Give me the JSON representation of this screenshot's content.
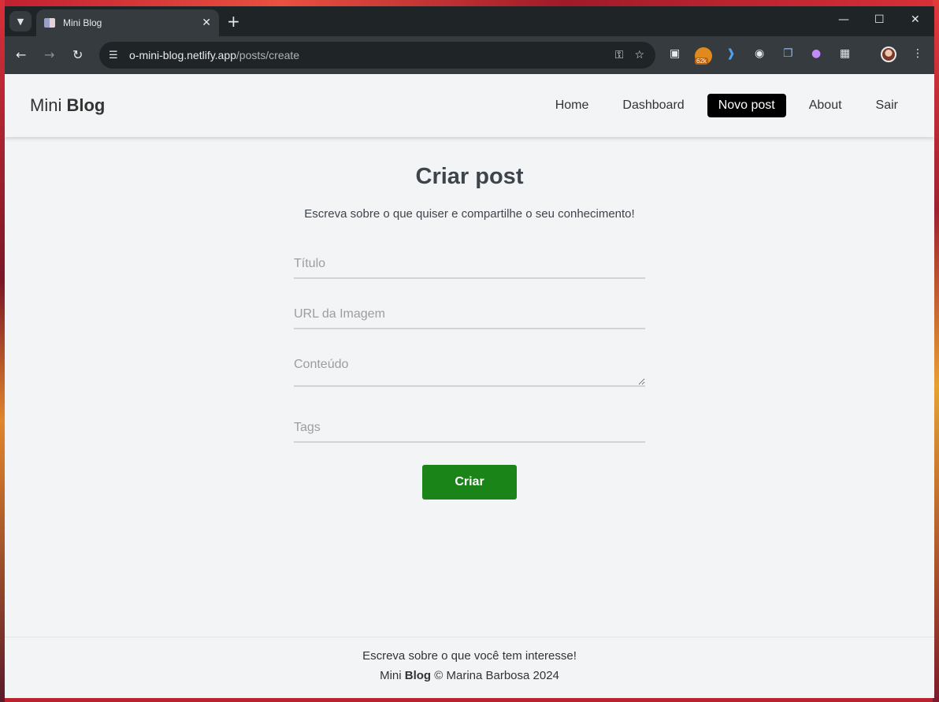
{
  "browser": {
    "tab_title": "Mini Blog",
    "url_host": "o-mini-blog.netlify.app",
    "url_path": "/posts/create",
    "ext_badge": "62k"
  },
  "navbar": {
    "brand_light": "Mini ",
    "brand_bold": "Blog",
    "links": [
      "Home",
      "Dashboard",
      "Novo post",
      "About",
      "Sair"
    ],
    "active": "Novo post"
  },
  "main": {
    "title": "Criar post",
    "subtitle": "Escreva sobre o que quiser e compartilhe o seu conhecimento!",
    "fields": {
      "title_placeholder": "Título",
      "image_placeholder": "URL da Imagem",
      "content_placeholder": "Conteúdo",
      "tags_placeholder": "Tags"
    },
    "submit_label": "Criar"
  },
  "footer": {
    "line1": "Escreva sobre o que você tem interesse!",
    "brand_light": "Mini ",
    "brand_bold": "Blog",
    "copyright": " © Marina Barbosa 2024"
  }
}
